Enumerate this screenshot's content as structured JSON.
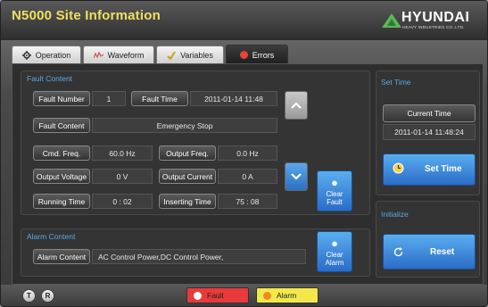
{
  "app": {
    "title": "N5000 Site Information"
  },
  "brand": {
    "name": "HYUNDAI",
    "subtitle": "HEAVY INDUSTRIES CO.,LTD.",
    "accent": "#5fb55a"
  },
  "tabs": [
    {
      "label": "Operation",
      "icon": "gear-icon",
      "active": false
    },
    {
      "label": "Waveform",
      "icon": "waveform-icon",
      "active": false
    },
    {
      "label": "Variables",
      "icon": "check-icon",
      "active": false
    },
    {
      "label": "Errors",
      "icon": "error-icon",
      "active": true
    }
  ],
  "fault": {
    "section_title": "Fault Content",
    "number_label": "Fault Number",
    "number_value": "1",
    "time_label": "Fault Time",
    "time_value": "2011-01-14 11:48",
    "content_label": "Fault Content",
    "content_value": "Emergency Stop",
    "cmd_freq_label": "Cmd. Freq.",
    "cmd_freq_value": "60.0 Hz",
    "output_freq_label": "Output Freq.",
    "output_freq_value": "0.0 Hz",
    "output_voltage_label": "Output Voltage",
    "output_voltage_value": "0 V",
    "output_current_label": "Output Current",
    "output_current_value": "0 A",
    "running_time_label": "Running Time",
    "running_time_value": "0 : 02",
    "inserting_time_label": "Inserting Time",
    "inserting_time_value": "75 : 08",
    "clear_label": "Clear Fault"
  },
  "alarm": {
    "section_title": "Alarm Content",
    "content_label": "Alarm Content",
    "content_value": "AC Control Power,DC Control Power,",
    "clear_label": "Clear Alarm"
  },
  "set_time": {
    "section_title": "Set Time",
    "current_label": "Current Time",
    "current_value": "2011-01-14 11:48:24",
    "button_label": "Set Time"
  },
  "initialize": {
    "section_title": "Initialize",
    "button_label": "Reset"
  },
  "footer": {
    "t_label": "T",
    "r_label": "R",
    "fault_label": "Fault",
    "alarm_label": "Alarm",
    "fault_color": "#e83a3a",
    "alarm_color": "#f2e84a"
  }
}
